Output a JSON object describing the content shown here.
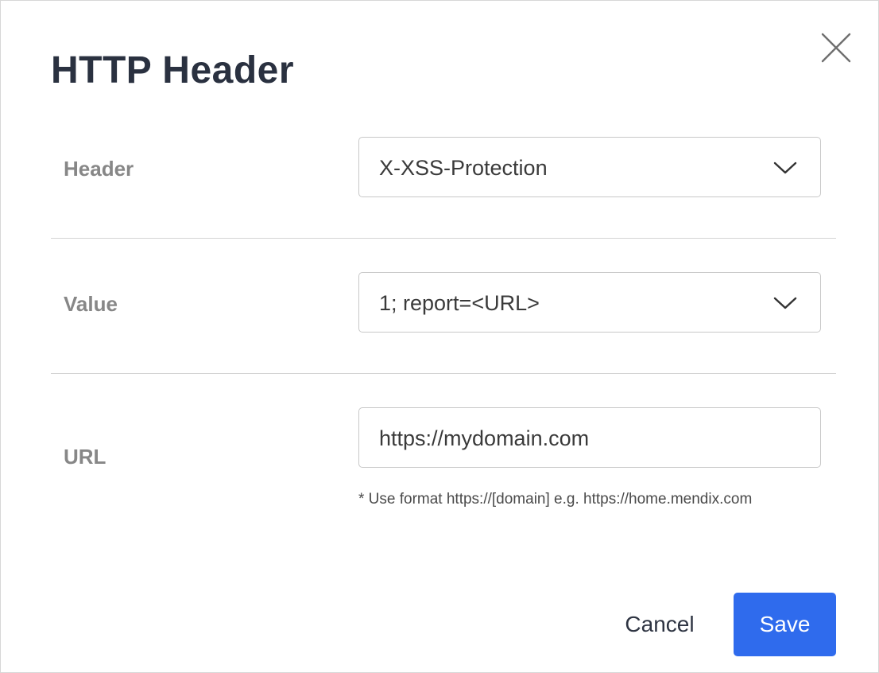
{
  "dialog": {
    "title": "HTTP Header",
    "close_icon": "close-icon"
  },
  "header_row": {
    "label": "Header",
    "selected_value": "X-XSS-Protection",
    "icon": "chevron-down-icon"
  },
  "value_row": {
    "label": "Value",
    "selected_value": "1; report=<URL>",
    "icon": "chevron-down-icon"
  },
  "url_row": {
    "label": "URL",
    "value": "https://mydomain.com",
    "hint": "* Use format https://[domain] e.g. https://home.mendix.com"
  },
  "footer": {
    "cancel_label": "Cancel",
    "save_label": "Save"
  },
  "colors": {
    "primary": "#2f6bed",
    "title": "#2a3140",
    "label": "#878787",
    "border": "#c8c8c8"
  }
}
